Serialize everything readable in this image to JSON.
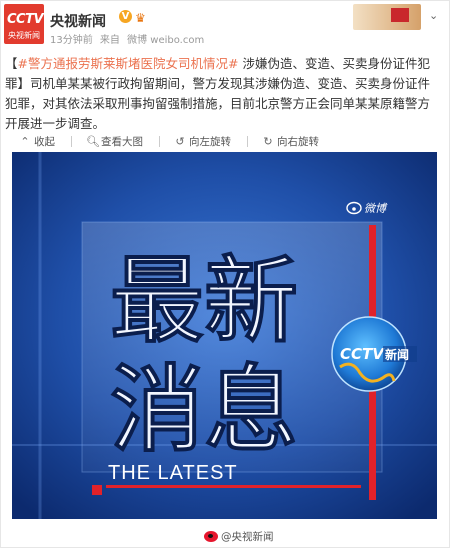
{
  "header": {
    "avatar_label": "CCTV",
    "avatar_caption": "央视新闻",
    "author": "央视新闻",
    "verified_mark": "V",
    "badge_icon": "crown-icon",
    "time": "13分钟前",
    "source_prefix": "来自",
    "source": "微博 weibo.com"
  },
  "post": {
    "bracket_open": "【",
    "hashtag": "#警方通报劳斯莱斯堵医院女司机情况#",
    "body": " 涉嫌伪造、变造、买卖身份证件犯罪】司机单某某被行政拘留期间，警方发现其涉嫌伪造、变造、买卖身份证件犯罪，对其依法采取刑事拘留强制措施，目前北京警方正会同单某某原籍警方开展进一步调查。"
  },
  "toolbar": {
    "collapse": "收起",
    "view_large": "查看大图",
    "rotate_left": "向左旋转",
    "rotate_right": "向右旋转"
  },
  "image": {
    "headline_top": "最新",
    "headline_bottom": "消息",
    "subtitle": "THE LATEST",
    "weibo_mark": "微博",
    "logo_text": "CCTV",
    "logo_sub": "新闻"
  },
  "caption": "@央视新闻",
  "colors": {
    "accent": "#eb7350",
    "brand_red": "#e23b2e",
    "image_blue": "#1f4fa8"
  }
}
